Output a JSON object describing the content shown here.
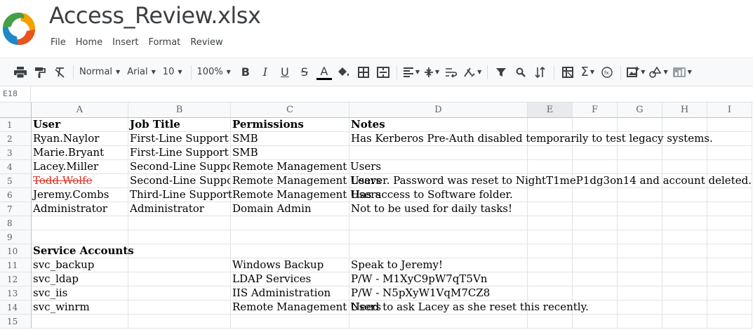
{
  "app": {
    "doc_title": "Access_Review.xlsx",
    "menu": [
      "File",
      "Home",
      "Insert",
      "Format",
      "Review"
    ]
  },
  "toolbar": {
    "style_value": "Normal",
    "font_value": "Arial",
    "size_value": "10",
    "zoom_value": "100%"
  },
  "formula_bar": {
    "cell_ref": "E18"
  },
  "sheet": {
    "columns": [
      "A",
      "B",
      "C",
      "D",
      "E",
      "F",
      "G",
      "H",
      "I"
    ],
    "selected_column": "E",
    "rows": [
      [
        "User",
        "Job Title",
        "Permissions",
        "Notes"
      ],
      [
        "Ryan.Naylor",
        "First-Line Support",
        "SMB",
        "Has Kerberos Pre-Auth disabled temporarily to test legacy systems."
      ],
      [
        "Marie.Bryant",
        "First-Line Support",
        "SMB",
        ""
      ],
      [
        "Lacey.Miller",
        "Second-Line Support",
        "Remote Management Users",
        ""
      ],
      [
        "Todd.Wolfe",
        "Second-Line Support",
        "Remote Management Users",
        "Leaver. Password was reset to NightT1meP1dg3on14 and account deleted."
      ],
      [
        "Jeremy.Combs",
        "Third-Line Support",
        "Remote Management Users",
        "Has access to Software folder."
      ],
      [
        "Administrator",
        "Administrator",
        "Domain Admin",
        "Not to be used for daily tasks!"
      ],
      [
        "",
        "",
        "",
        ""
      ],
      [
        "",
        "",
        "",
        ""
      ],
      [
        "Service Accounts",
        "",
        "",
        ""
      ],
      [
        "svc_backup",
        "",
        "Windows Backup",
        "Speak to Jeremy!"
      ],
      [
        "svc_ldap",
        "",
        "LDAP Services",
        "P/W - M1XyC9pW7qT5Vn"
      ],
      [
        "svc_iis",
        "",
        "IIS Administration",
        "P/W - N5pXyW1VqM7CZ8"
      ],
      [
        "svc_winrm",
        "",
        "Remote Management Users",
        "Need to ask Lacey as she reset this recently."
      ],
      [
        "",
        "",
        "",
        ""
      ]
    ]
  }
}
